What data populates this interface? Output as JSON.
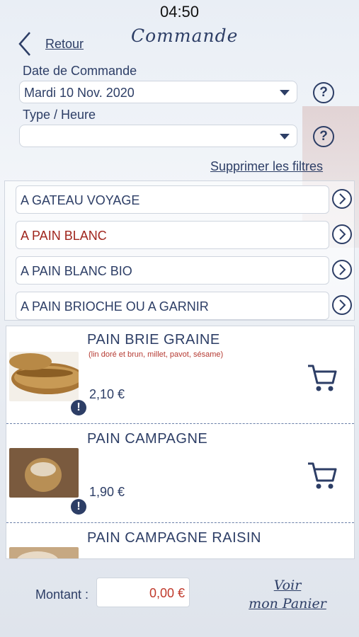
{
  "status": {
    "time": "04:50"
  },
  "header": {
    "back_label": "Retour",
    "title": "Commande"
  },
  "filters": {
    "date_label": "Date de Commande",
    "date_value": "Mardi 10 Nov. 2020",
    "type_label": "Type / Heure",
    "type_value": "",
    "clear_label": "Supprimer les filtres"
  },
  "categories": [
    {
      "label": "A GATEAU VOYAGE",
      "color": "#2d3e66"
    },
    {
      "label": "A PAIN BLANC",
      "color": "#a0261e"
    },
    {
      "label": "A PAIN BLANC BIO",
      "color": "#2d3e66"
    },
    {
      "label": "A PAIN BRIOCHE OU A GARNIR",
      "color": "#2d3e66"
    }
  ],
  "products": [
    {
      "name": "PAIN BRIE GRAINE",
      "desc": "(lin doré et brun, millet, pavot, sésame)",
      "price": "2,10 €"
    },
    {
      "name": "PAIN CAMPAGNE",
      "desc": "",
      "price": "1,90 €"
    },
    {
      "name": "PAIN CAMPAGNE RAISIN",
      "desc": "",
      "price": ""
    }
  ],
  "footer": {
    "amount_label": "Montant :",
    "amount_value": "0,00 €",
    "cart_line1": "Voir",
    "cart_line2": "mon Panier"
  },
  "icons": {
    "help": "?",
    "info": "!"
  }
}
